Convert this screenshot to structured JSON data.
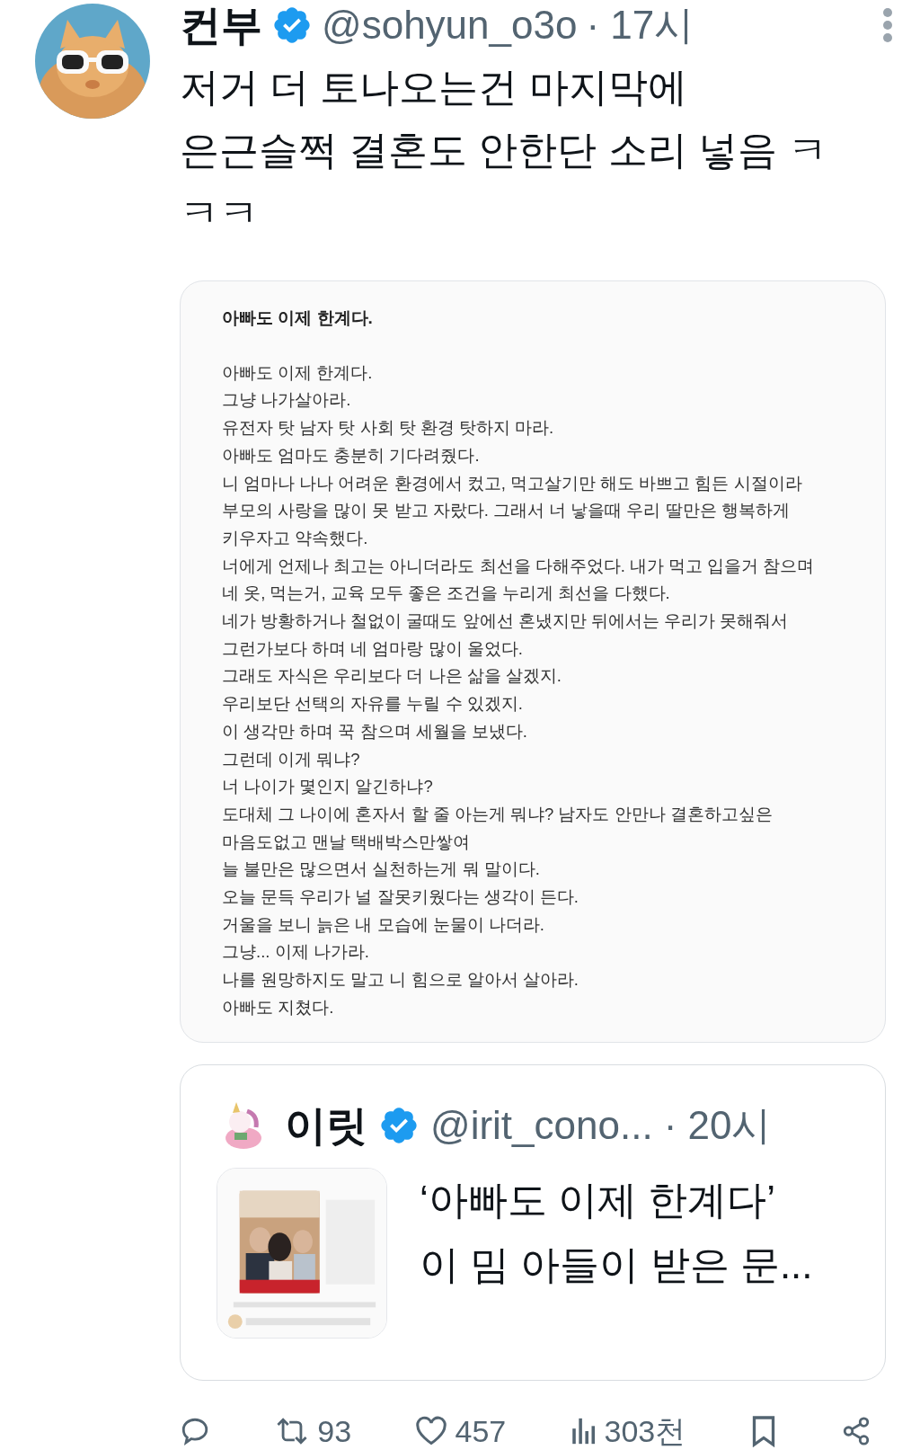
{
  "tweet": {
    "name": "컨부",
    "verified": true,
    "handle": "@sohyun_o3o",
    "time": "· 17시",
    "text_lines": [
      "저거 더 토나오는건 마지막에",
      "은근슬쩍 결혼도 안한단 소리 넣음 ㅋ",
      "ㅋㅋ"
    ]
  },
  "image_card": {
    "title": "아빠도 이제 한계다.",
    "lines": [
      "아빠도 이제 한계다.",
      "그냥 나가살아라.",
      "유전자 탓 남자 탓 사회 탓 환경 탓하지 마라.",
      "아빠도 엄마도 충분히 기다려줬다.",
      "니 엄마나 나나 어려운 환경에서 컸고, 먹고살기만 해도 바쁘고 힘든 시절이라",
      "부모의 사랑을 많이 못 받고 자랐다. 그래서 너 낳을때 우리 딸만은 행복하게",
      "키우자고 약속했다.",
      "너에게 언제나 최고는 아니더라도 최선을 다해주었다. 내가 먹고 입을거 참으며",
      "네 옷, 먹는거, 교육 모두 좋은 조건을 누리게 최선을 다했다.",
      "네가 방황하거나 철없이 굴때도 앞에선 혼냈지만 뒤에서는 우리가 못해줘서",
      "그런가보다 하며 네 엄마랑 많이 울었다.",
      "그래도 자식은 우리보다 더 나은 삶을 살겠지.",
      "우리보단 선택의 자유를 누릴 수 있겠지.",
      "이 생각만 하며 꾹 참으며 세월을 보냈다.",
      "그런데 이게 뭐냐?",
      "너 나이가 몇인지 알긴하냐?",
      "도대체 그 나이에 혼자서 할 줄 아는게 뭐냐? 남자도 안만나 결혼하고싶은",
      "마음도없고 맨날 택배박스만쌓여",
      "늘 불만은 많으면서 실천하는게 뭐 말이다.",
      "오늘 문득 우리가 널 잘못키웠다는 생각이 든다.",
      "거울을 보니 늙은 내 모습에 눈물이 나더라.",
      "그냥... 이제 나가라.",
      "나를 원망하지도 말고 니 힘으로 알아서 살아라.",
      "아빠도 지쳤다."
    ]
  },
  "quoted": {
    "name": "이릿",
    "verified": true,
    "handle": "@irit_cono...",
    "time": "· 20시",
    "text_lines": [
      "‘아빠도 이제 한계다’",
      "이 밈 아들이 받은 문..."
    ]
  },
  "actions": [
    {
      "kind": "reply"
    },
    {
      "kind": "retweet",
      "count": "93"
    },
    {
      "kind": "like",
      "count": "457"
    },
    {
      "kind": "views",
      "count": "303천"
    },
    {
      "kind": "bookmark"
    },
    {
      "kind": "share"
    }
  ]
}
